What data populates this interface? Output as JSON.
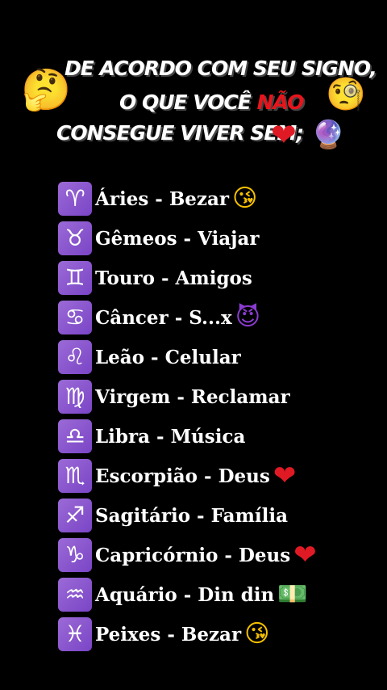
{
  "header": {
    "line1": "DE ACORDO COM SEU SIGNO,",
    "line2_prefix": "O QUE VOCÊ ",
    "line2_highlight": "NÃO",
    "line3": "CONSEGUE VIVER SEM;",
    "emoji_left": "🤔",
    "emoji_right": "🧐",
    "emoji_heart": "❤",
    "emoji_ball": "🔮",
    "highlight_color": "#e8141b"
  },
  "signs": [
    {
      "symbol": "♈",
      "label": "Áries - Bezar",
      "emoji": "😘",
      "emoji_name": "kiss-face-icon"
    },
    {
      "symbol": "♉",
      "label": "Gêmeos - Viajar",
      "emoji": "",
      "emoji_name": ""
    },
    {
      "symbol": "♊",
      "label": "Touro - Amigos",
      "emoji": "",
      "emoji_name": ""
    },
    {
      "symbol": "♋",
      "label": "Câncer - S...x",
      "emoji": "😈",
      "emoji_name": "devil-face-icon"
    },
    {
      "symbol": "♌",
      "label": "Leão - Celular",
      "emoji": "",
      "emoji_name": ""
    },
    {
      "symbol": "♍",
      "label": "Virgem - Reclamar",
      "emoji": "",
      "emoji_name": ""
    },
    {
      "symbol": "♎",
      "label": "Libra - Música",
      "emoji": "",
      "emoji_name": ""
    },
    {
      "symbol": "♏",
      "label": "Escorpião - Deus",
      "emoji": "❤",
      "emoji_name": "heart-icon"
    },
    {
      "symbol": "♐",
      "label": "Sagitário - Família",
      "emoji": "",
      "emoji_name": ""
    },
    {
      "symbol": "♑",
      "label": "Capricórnio - Deus",
      "emoji": "❤",
      "emoji_name": "heart-icon"
    },
    {
      "symbol": "♒",
      "label": "Aquário - Din din",
      "emoji": "💵",
      "emoji_name": "money-icon"
    },
    {
      "symbol": "♓",
      "label": "Peixes - Bezar",
      "emoji": "😘",
      "emoji_name": "kiss-face-icon"
    }
  ],
  "colors": {
    "background": "#000000",
    "symbol_bg": "#8a57cf",
    "heart": "#e01a24"
  }
}
